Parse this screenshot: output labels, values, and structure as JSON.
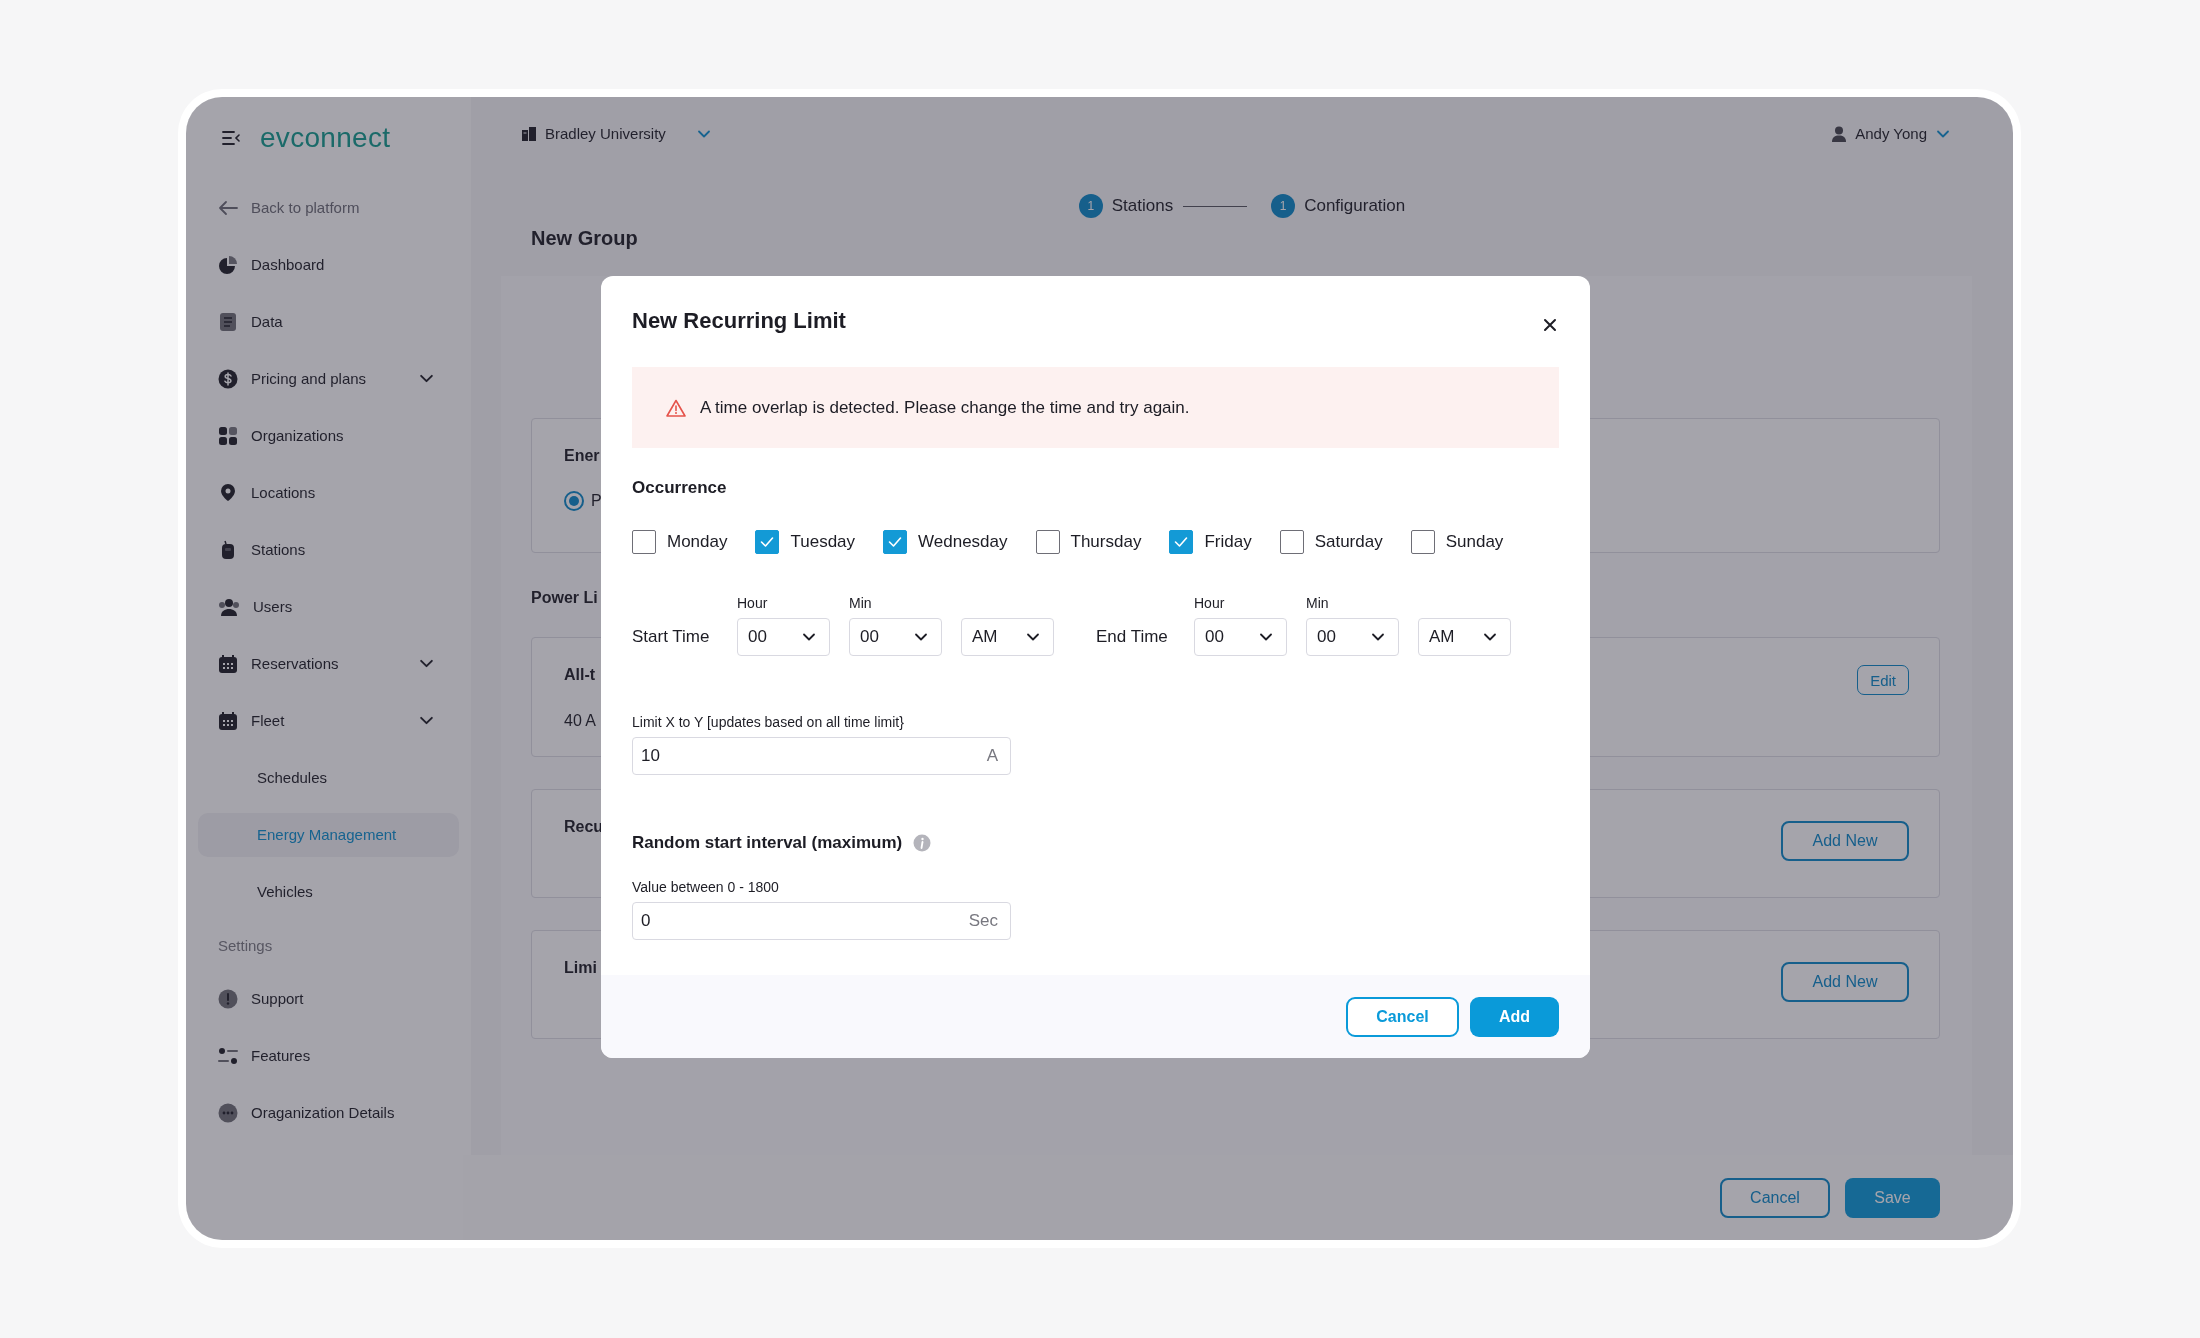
{
  "app": {
    "logo": "evconnect",
    "organization": "Bradley University",
    "user": "Andy Yong"
  },
  "sidebar": {
    "back": "Back to platform",
    "items": [
      {
        "label": "Dashboard",
        "selected": false
      },
      {
        "label": "Data",
        "selected": false
      },
      {
        "label": "Pricing and plans",
        "selected": false,
        "expandable": true
      },
      {
        "label": "Organizations",
        "selected": false
      },
      {
        "label": "Locations",
        "selected": false
      },
      {
        "label": "Stations",
        "selected": false
      },
      {
        "label": "Users",
        "selected": false
      },
      {
        "label": "Reservations",
        "selected": false,
        "expandable": true
      },
      {
        "label": "Fleet",
        "selected": false,
        "expandable": true,
        "children": [
          {
            "label": "Schedules",
            "selected": false
          },
          {
            "label": "Energy Management",
            "selected": true
          },
          {
            "label": "Vehicles",
            "selected": false
          }
        ]
      }
    ],
    "settings_heading": "Settings",
    "settings_items": [
      {
        "label": "Support",
        "selected": false
      },
      {
        "label": "Features",
        "selected": false
      },
      {
        "label": "Oraganization Details",
        "selected": false
      }
    ]
  },
  "stepper": [
    {
      "number": "1",
      "label": "Stations"
    },
    {
      "number": "1",
      "label": "Configuration"
    }
  ],
  "page": {
    "title": "New Group",
    "energy_card": {
      "title": "Ener",
      "option": {
        "label": "P",
        "selected": true
      }
    },
    "section_title": "Power Li",
    "cards": [
      {
        "title": "All-t",
        "value": "40 A",
        "button": "Edit",
        "kind": "small"
      },
      {
        "title": "Recu",
        "button": "Add New",
        "kind": "large"
      },
      {
        "title": "Limi",
        "button": "Add New",
        "kind": "large"
      }
    ],
    "buttons": [
      {
        "label": "Cancel",
        "kind": "secondary"
      },
      {
        "label": "Save",
        "kind": "primary"
      }
    ]
  },
  "modal": {
    "title": "New Recurring Limit",
    "alert": "A time overlap is detected. Please change the time and try again.",
    "occurrence_title": "Occurrence",
    "days": [
      {
        "label": "Monday",
        "checked": false
      },
      {
        "label": "Tuesday",
        "checked": true
      },
      {
        "label": "Wednesday",
        "checked": true
      },
      {
        "label": "Thursday",
        "checked": false
      },
      {
        "label": "Friday",
        "checked": true
      },
      {
        "label": "Saturday",
        "checked": false
      },
      {
        "label": "Sunday",
        "checked": false
      }
    ],
    "times": [
      {
        "label": "Start Time",
        "hour_label": "Hour",
        "hour": "00",
        "min_label": "Min",
        "min": "00",
        "period": "AM"
      },
      {
        "label": "End Time",
        "hour_label": "Hour",
        "hour": "00",
        "min_label": "Min",
        "min": "00",
        "period": "AM"
      }
    ],
    "limit": {
      "label": "Limit X to Y [updates based on all time limit}",
      "value": "10",
      "unit": "A"
    },
    "random": {
      "title": "Random start interval (maximum)",
      "label": "Value between 0 - 1800",
      "value": "0",
      "unit": "Sec"
    },
    "buttons": [
      {
        "label": "Cancel",
        "kind": "secondary"
      },
      {
        "label": "Add",
        "kind": "primary"
      }
    ]
  }
}
